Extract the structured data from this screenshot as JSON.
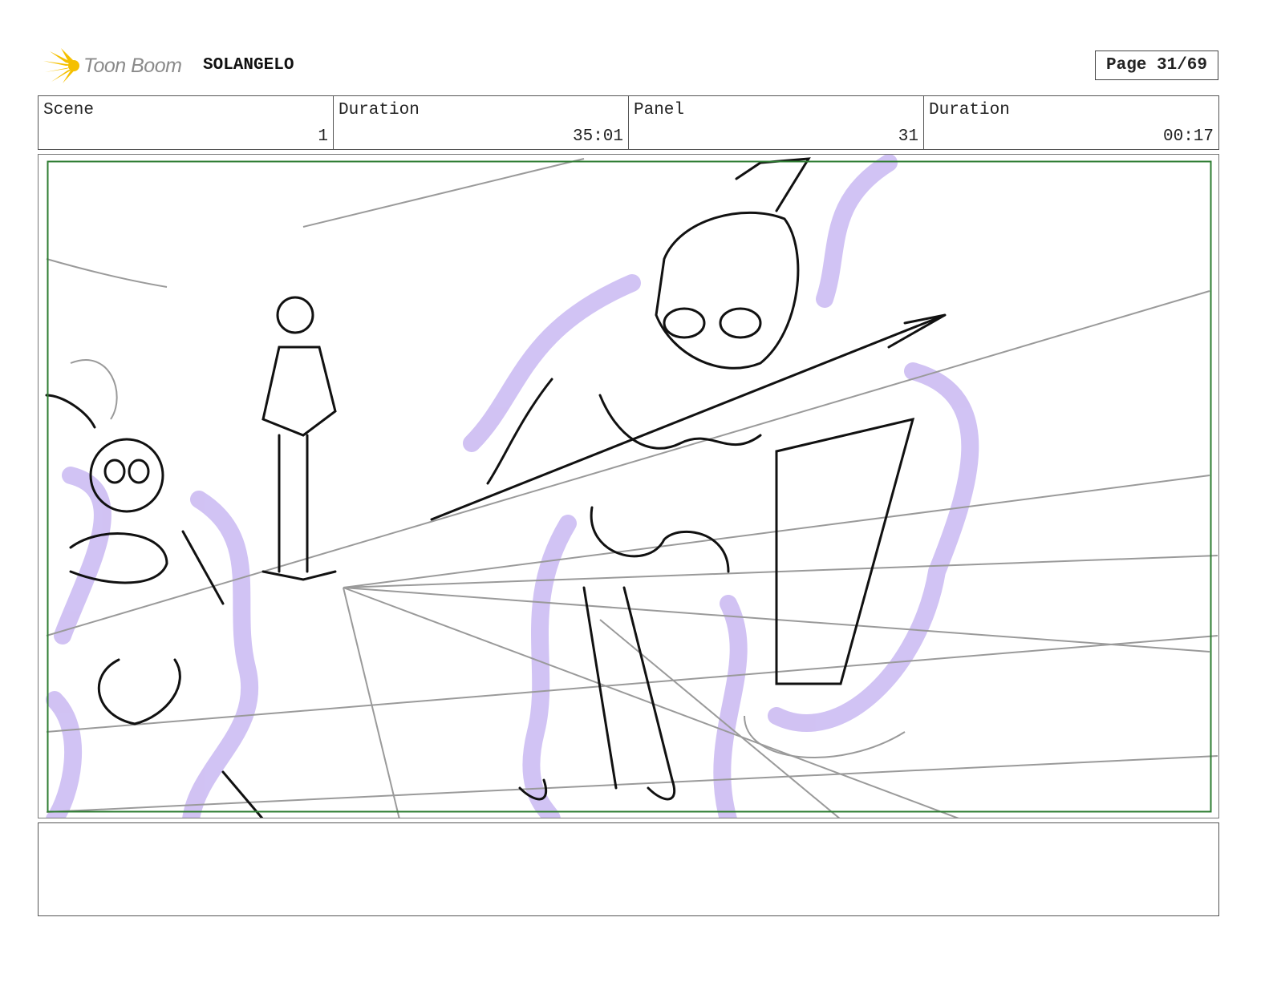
{
  "header": {
    "logo_text": "Toon Boom",
    "project_title": "SOLANGELO",
    "page_label": "Page 31/69"
  },
  "info": {
    "scene_label": "Scene",
    "scene_value": "1",
    "scene_duration_label": "Duration",
    "scene_duration_value": "35:01",
    "panel_label": "Panel",
    "panel_value": "31",
    "panel_duration_label": "Duration",
    "panel_duration_value": "00:17"
  },
  "colors": {
    "safe_frame": "#2e7d32",
    "aura": "#c9b8f2",
    "logo_burst": "#f5c000"
  },
  "notes": {
    "text": ""
  }
}
